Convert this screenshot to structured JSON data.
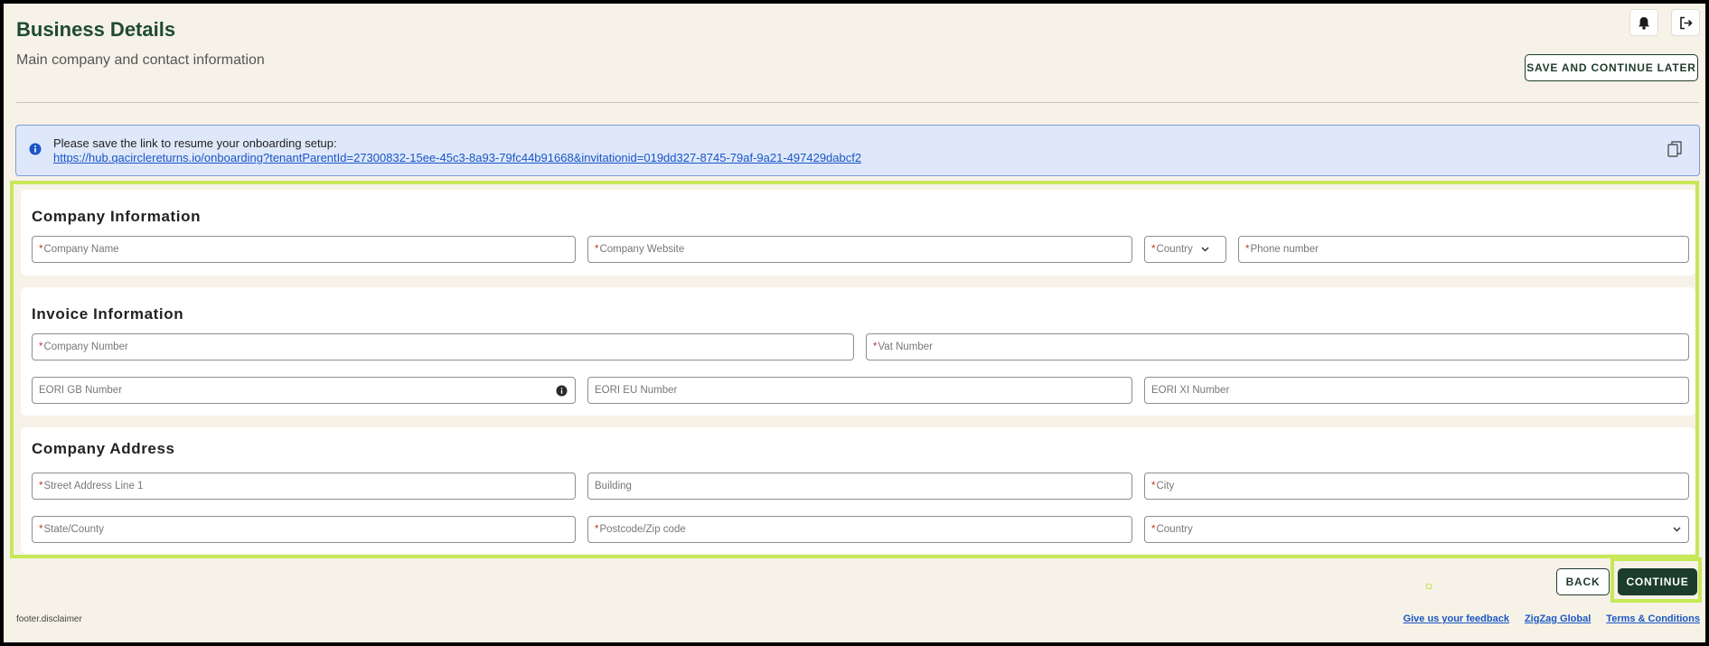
{
  "header": {
    "title": "Business Details",
    "subtitle": "Main company and contact information",
    "icons": [
      "bell-icon",
      "logout-icon"
    ],
    "save_later_label": "SAVE AND CONTINUE LATER"
  },
  "banner": {
    "icon": "info-icon",
    "text": "Please save the link to resume your onboarding setup:",
    "link": "https://hub.qacirclereturns.io/onboarding?tenantParentId=27300832-15ee-45c3-8a93-79fc44b91668&invitationid=019dd327-8745-79af-9a21-497429dabcf2",
    "copy_icon": "copy-icon"
  },
  "sections": {
    "company": {
      "title": "Company Information",
      "fields": {
        "name": "Company Name",
        "website": "Company Website",
        "country": "Country",
        "phone": "Phone number"
      }
    },
    "invoice": {
      "title": "Invoice Information",
      "fields": {
        "company_number": "Company Number",
        "vat_number": "Vat Number",
        "eori_gb": "EORI GB Number",
        "eori_eu": "EORI EU Number",
        "eori_xi": "EORI XI Number"
      }
    },
    "address": {
      "title": "Company Address",
      "fields": {
        "street": "Street Address Line 1",
        "building": "Building",
        "city": "City",
        "state": "State/County",
        "postcode": "Postcode/Zip code",
        "country": "Country"
      }
    }
  },
  "actions": {
    "back_label": "BACK",
    "continue_label": "CONTINUE"
  },
  "footer": {
    "disclaimer": "footer.disclaimer",
    "links": [
      "Give us your feedback",
      "ZigZag Global",
      "Terms & Conditions"
    ]
  },
  "colors": {
    "brand_green": "#1c3d2b",
    "title_green": "#1e4a32",
    "highlight": "#c7e858",
    "banner_bg": "#dfe8fb",
    "link_blue": "#1a56c4",
    "page_bg": "#f6f2e7"
  }
}
